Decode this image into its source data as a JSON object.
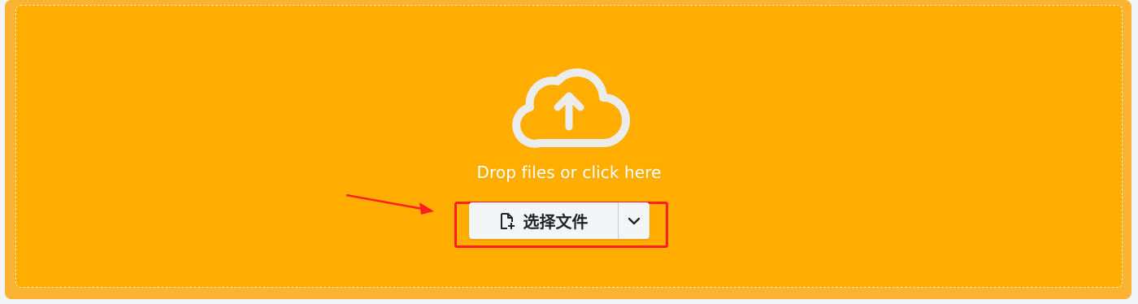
{
  "dropzone": {
    "prompt": "Drop files or click here",
    "icon": "cloud-upload-icon"
  },
  "upload_button": {
    "label": "选择文件",
    "icon": "file-add-icon",
    "dropdown_icon": "chevron-down-icon"
  },
  "annotation": {
    "arrow_color": "#ff1f1f",
    "highlight_color": "#ff1f1f"
  },
  "colors": {
    "outer_bg": "#fbb331",
    "dropzone_bg": "#ffae00",
    "button_bg": "#f4f5f7",
    "text_light": "#ffffff",
    "text_dark": "#1f2329"
  }
}
